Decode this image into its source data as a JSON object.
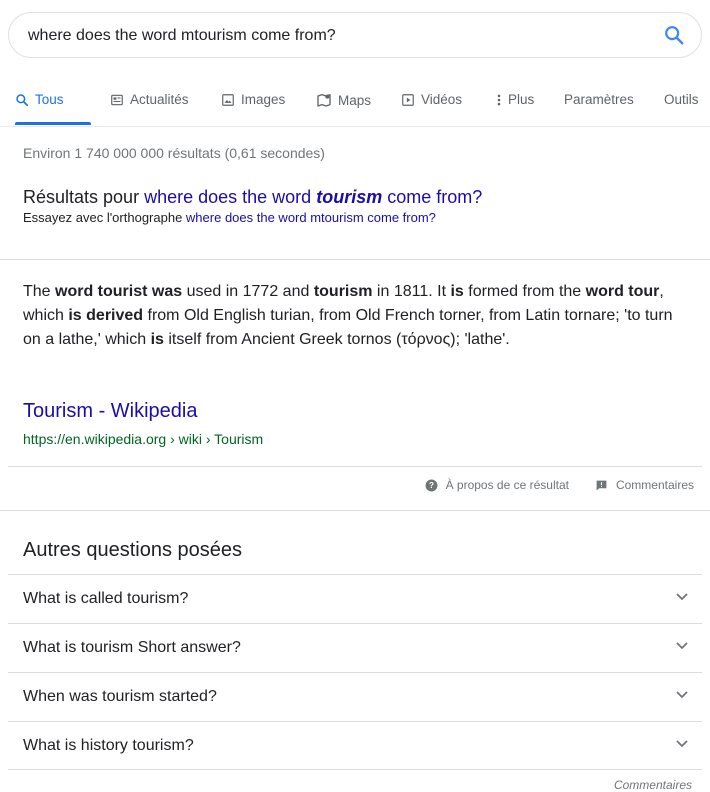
{
  "search": {
    "query": "where does the word mtourism come from?",
    "icon": "search-icon"
  },
  "tabs": [
    {
      "label": "Tous",
      "icon": "search-icon",
      "active": true
    },
    {
      "label": "Actualités",
      "icon": "news-icon"
    },
    {
      "label": "Images",
      "icon": "image-icon"
    },
    {
      "label": "Maps",
      "icon": "map-icon"
    },
    {
      "label": "Vidéos",
      "icon": "video-icon"
    },
    {
      "label": "Plus",
      "icon": "more-vert-icon"
    },
    {
      "label": "Paramètres"
    },
    {
      "label": "Outils"
    }
  ],
  "stats": "Environ 1 740 000 000 résultats (0,61 secondes)",
  "spelling": {
    "prefix": "Résultats pour",
    "corrected_before": "where does the word",
    "corrected_bold": "tourism",
    "corrected_after": "come from?",
    "alt_prefix": "Essayez avec l'orthographe",
    "alt_query": "where does the word mtourism come from?"
  },
  "snippet": {
    "segments": [
      {
        "t": "The ",
        "b": false
      },
      {
        "t": "word tourist was",
        "b": true
      },
      {
        "t": " used in 1772 and ",
        "b": false
      },
      {
        "t": "tourism",
        "b": true
      },
      {
        "t": " in 1811. It ",
        "b": false
      },
      {
        "t": "is",
        "b": true
      },
      {
        "t": " formed from the ",
        "b": false
      },
      {
        "t": "word tour",
        "b": true
      },
      {
        "t": ", which ",
        "b": false
      },
      {
        "t": "is derived",
        "b": true
      },
      {
        "t": " from Old English turian, from Old French torner, from Latin tornare; 'to turn on a lathe,' which ",
        "b": false
      },
      {
        "t": "is",
        "b": true
      },
      {
        "t": " itself from Ancient Greek tornos (τόρνος); 'lathe'.",
        "b": false
      }
    ],
    "source_title": "Tourism - Wikipedia",
    "source_url": "https://en.wikipedia.org › wiki › Tourism"
  },
  "about": {
    "about_label": "À propos de ce résultat",
    "feedback_label": "Commentaires"
  },
  "paa": {
    "title": "Autres questions posées",
    "questions": [
      "What is called tourism?",
      "What is tourism Short answer?",
      "When was tourism started?",
      "What is history tourism?"
    ],
    "feedback": "Commentaires"
  },
  "colors": {
    "link": "#1a0dab",
    "accent": "#1a73e8",
    "url_green": "#006621",
    "muted": "#70757a"
  }
}
